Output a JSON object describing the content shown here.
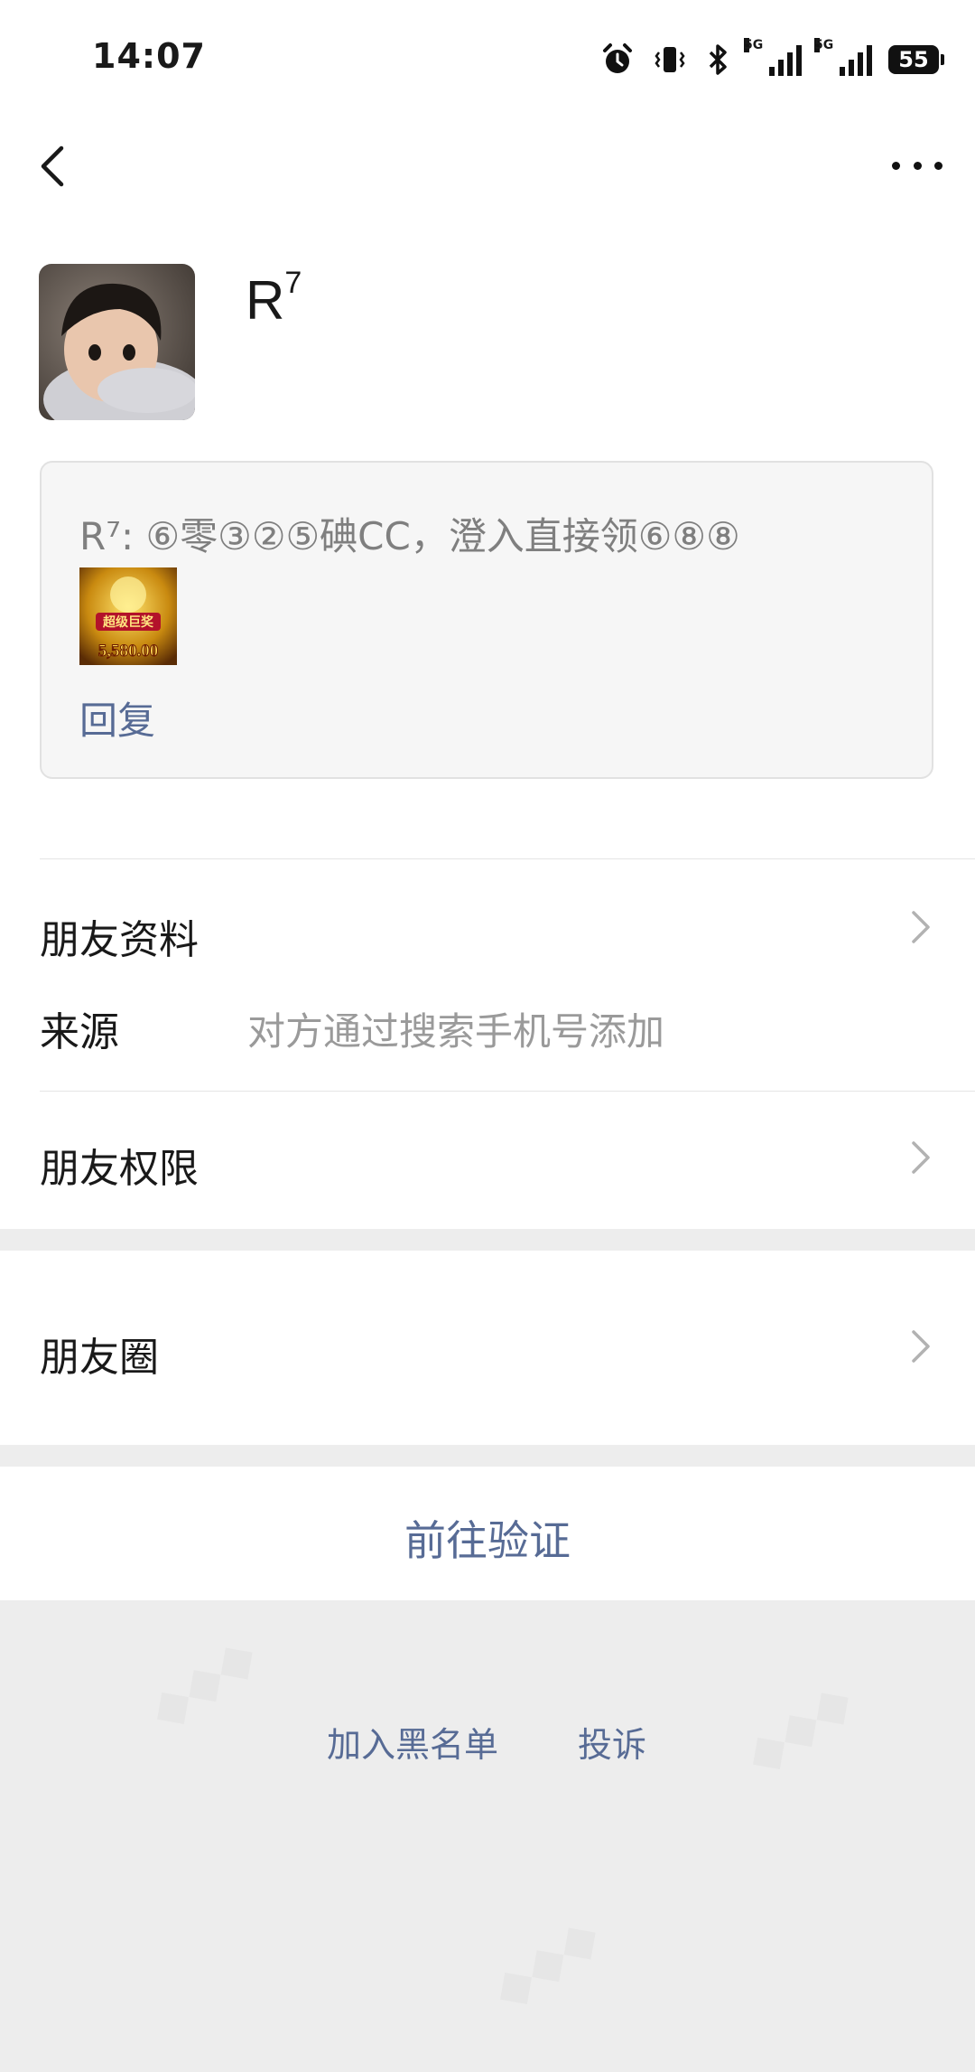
{
  "status_bar": {
    "time": "14:07",
    "network_1": "5G",
    "network_2": "5G",
    "battery": "55",
    "icons": [
      "alarm-icon",
      "vibrate-icon",
      "bluetooth-icon",
      "signal-icon",
      "signal-icon",
      "battery-icon"
    ]
  },
  "nav": {
    "back_icon": "chevron-left-icon",
    "more_icon": "more-horizontal-icon"
  },
  "profile": {
    "nickname": "R",
    "nickname_sup": "7"
  },
  "greeting": {
    "message": "R⁷: ⑥零③②⑤碘CC，澄入直接领⑥⑧⑧",
    "thumbnail_caption": "超级巨奖",
    "thumbnail_amount": "5,580.00",
    "reply_label": "回复"
  },
  "rows": {
    "friend_info": "朋友资料",
    "source_label": "来源",
    "source_value": "对方通过搜索手机号添加",
    "permissions": "朋友权限",
    "moments": "朋友圈"
  },
  "actions": {
    "verify": "前往验证",
    "blacklist": "加入黑名单",
    "report": "投诉"
  },
  "colors": {
    "link": "#576b95",
    "background": "#ededed",
    "card": "#f6f6f6"
  }
}
